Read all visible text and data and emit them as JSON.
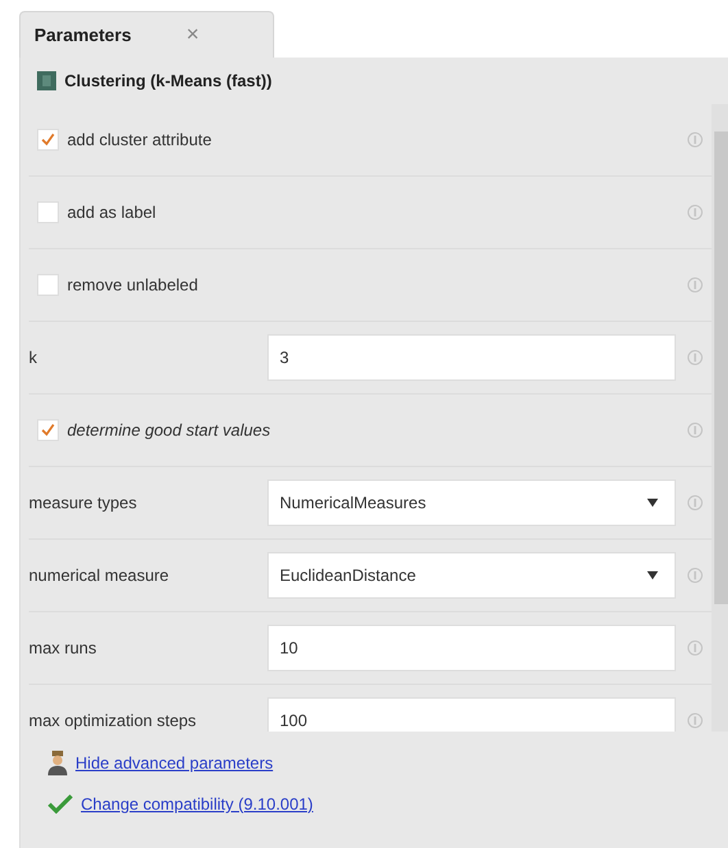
{
  "tab": {
    "label": "Parameters",
    "close": "×"
  },
  "operator": {
    "title": "Clustering (k-Means (fast))"
  },
  "parameters": [
    {
      "kind": "checkbox",
      "label": "add cluster attribute",
      "checked": true,
      "italic": false
    },
    {
      "kind": "checkbox",
      "label": "add as label",
      "checked": false,
      "italic": false
    },
    {
      "kind": "checkbox",
      "label": "remove unlabeled",
      "checked": false,
      "italic": false
    },
    {
      "kind": "text",
      "label": "k",
      "value": "3"
    },
    {
      "kind": "checkbox",
      "label": "determine good start values",
      "checked": true,
      "italic": true
    },
    {
      "kind": "select",
      "label": "measure types",
      "value": "NumericalMeasures"
    },
    {
      "kind": "select",
      "label": "numerical measure",
      "value": "EuclideanDistance"
    },
    {
      "kind": "text",
      "label": "max runs",
      "value": "10"
    },
    {
      "kind": "text",
      "label": "max optimization steps",
      "value": "100"
    }
  ],
  "links": [
    {
      "kind": "advanced",
      "label": "Hide advanced parameters"
    },
    {
      "kind": "compat",
      "label": "Change compatibility (9.10.001)"
    }
  ]
}
